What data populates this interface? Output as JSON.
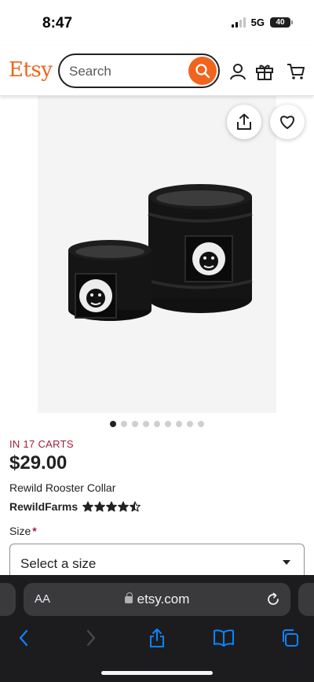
{
  "status": {
    "time": "8:47",
    "network": "5G",
    "battery": "40"
  },
  "header": {
    "logo": "Etsy",
    "search_placeholder": "Search"
  },
  "carousel": {
    "image_count": 9,
    "active_index": 0
  },
  "product": {
    "carts": "IN 17 CARTS",
    "price": "$29.00",
    "title": "Rewild Rooster Collar",
    "shop": "RewildFarms",
    "rating": 4.5
  },
  "size": {
    "label": "Size",
    "required_mark": "*",
    "placeholder": "Select a size"
  },
  "browser": {
    "text_size_label": "AA",
    "url": "etsy.com"
  },
  "colors": {
    "brand": "#f1641e",
    "carts": "#9c1f3a",
    "safari_bg": "#1c1c1e",
    "safari_accent": "#0a84ff"
  }
}
